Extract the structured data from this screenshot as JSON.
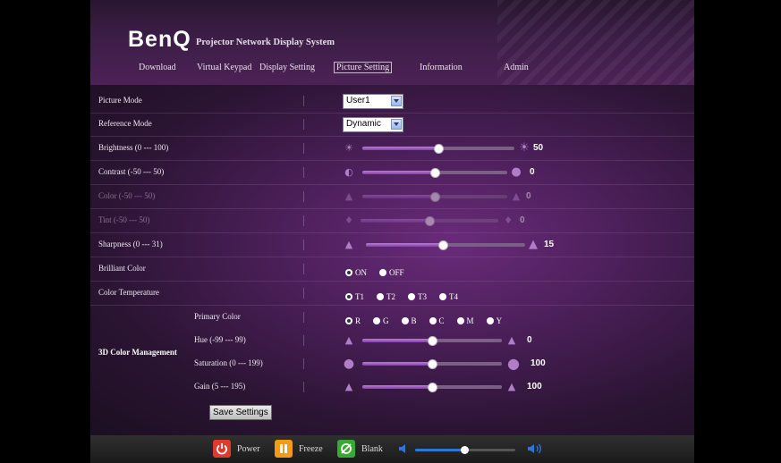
{
  "header": {
    "logo": "BenQ",
    "subtitle": "Projector Network Display System",
    "nav": [
      {
        "label": "Download"
      },
      {
        "label": "Virtual Keypad"
      },
      {
        "label": "Display Setting"
      },
      {
        "label": "Picture Setting",
        "active": true
      },
      {
        "label": "Information"
      },
      {
        "label": "Admin"
      }
    ]
  },
  "settings": {
    "picture_mode": {
      "label": "Picture Mode",
      "value": "User1"
    },
    "reference_mode": {
      "label": "Reference Mode",
      "value": "Dynamic"
    },
    "brightness": {
      "label": "Brightness (0 --- 100)",
      "value": "50",
      "min": 0,
      "max": 100,
      "level": 50
    },
    "contrast": {
      "label": "Contrast (-50 --- 50)",
      "value": "0",
      "min": -50,
      "max": 50,
      "level": 0
    },
    "color": {
      "label": "Color (-50 --- 50)",
      "value": "0",
      "min": -50,
      "max": 50,
      "level": 0
    },
    "tint": {
      "label": "Tint (-50 --- 50)",
      "value": "0",
      "min": -50,
      "max": 50,
      "level": 0
    },
    "sharpness": {
      "label": "Sharpness (0 --- 31)",
      "value": "15",
      "min": 0,
      "max": 31,
      "level": 15
    },
    "brilliant_color": {
      "label": "Brilliant Color",
      "options": [
        "ON",
        "OFF"
      ],
      "selected": "ON"
    },
    "color_temperature": {
      "label": "Color Temperature",
      "options": [
        "T1",
        "T2",
        "T3",
        "T4"
      ],
      "selected": "T1"
    }
  },
  "color_management": {
    "title": "3D Color Management",
    "primary_color": {
      "label": "Primary Color",
      "options": [
        "R",
        "G",
        "B",
        "C",
        "M",
        "Y"
      ],
      "selected": "R"
    },
    "hue": {
      "label": "Hue (-99 --- 99)",
      "value": "0",
      "min": -99,
      "max": 99,
      "level": 0
    },
    "saturation": {
      "label": "Saturation (0 --- 199)",
      "value": "100",
      "min": 0,
      "max": 199,
      "level": 100
    },
    "gain": {
      "label": "Gain (5 --- 195)",
      "value": "100",
      "min": 5,
      "max": 195,
      "level": 100
    },
    "save_label": "Save Settings"
  },
  "footer": {
    "power": "Power",
    "freeze": "Freeze",
    "blank": "Blank",
    "volume_level": 0.5
  },
  "colors": {
    "accent": "#8640a9",
    "power": "#e0392f",
    "freeze": "#f39a1b",
    "blank": "#3aa832",
    "volume": "#2f74d8"
  }
}
